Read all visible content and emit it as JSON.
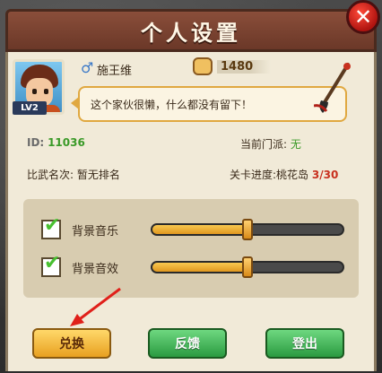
{
  "window": {
    "title": "个人设置",
    "close_symbol": "✕"
  },
  "profile": {
    "level_badge": "LV2",
    "gender_symbol": "♂",
    "name": "施王维",
    "power": "1480",
    "signature": "这个家伙很懒，什么都没有留下！"
  },
  "info": {
    "id_label": "ID:",
    "id_value": "11036",
    "faction_label": "当前门派:",
    "faction_value": "无",
    "rank_label": "比武名次:",
    "rank_value": "暂无排名",
    "progress_label": "关卡进度:",
    "progress_area": "桃花岛",
    "progress_value": "3/30"
  },
  "settings": {
    "music": {
      "label": "背景音乐",
      "checked": true,
      "level": 0.5
    },
    "sound": {
      "label": "背景音效",
      "checked": true,
      "level": 0.5
    }
  },
  "buttons": {
    "exchange": "兑换",
    "feedback": "反馈",
    "logout": "登出"
  },
  "colors": {
    "accent_green": "#3a9a28",
    "accent_red": "#c8301e",
    "title_bar": "#7a4230"
  }
}
